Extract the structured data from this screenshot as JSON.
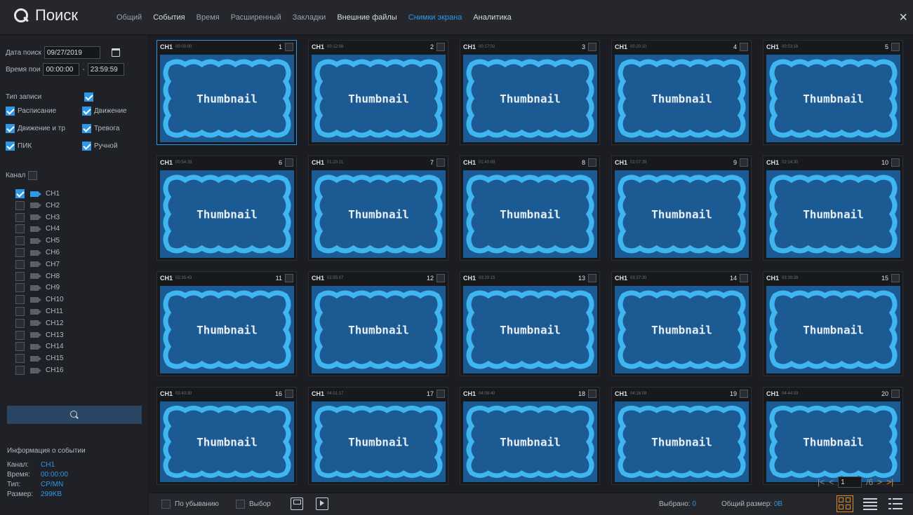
{
  "header": {
    "title": "Поиск",
    "tabs": [
      {
        "label": "Общий"
      },
      {
        "label": "События"
      },
      {
        "label": "Время"
      },
      {
        "label": "Расширенный"
      },
      {
        "label": "Закладки"
      },
      {
        "label": "Внешние файлы"
      },
      {
        "label": "Снимки экрана",
        "active": true
      },
      {
        "label": "Аналитика"
      }
    ],
    "close": "×"
  },
  "sidebar": {
    "date_label": "Дата поиск",
    "date_value": "09/27/2019",
    "time_label": "Время пои",
    "time_from": "00:00:00",
    "time_sep": "-",
    "time_to": "23:59:59",
    "rec_type_label": "Тип записи",
    "rec_types": [
      {
        "label": "Расписание"
      },
      {
        "label": "Движение"
      },
      {
        "label": "Движение и тр"
      },
      {
        "label": "Тревога"
      },
      {
        "label": "ПИК"
      },
      {
        "label": "Ручной"
      }
    ],
    "channel_label": "Канал",
    "channels": [
      "CH1",
      "CH2",
      "CH3",
      "CH4",
      "CH5",
      "CH6",
      "CH7",
      "CH8",
      "CH9",
      "CH10",
      "CH11",
      "CH12",
      "CH13",
      "CH14",
      "CH15",
      "CH16"
    ],
    "info_title": "Информация о событии",
    "info": {
      "channel_k": "Канал:",
      "channel_v": "CH1",
      "time_k": "Время:",
      "time_v": "00:00:00",
      "type_k": "Тип:",
      "type_v": "CP/MN",
      "size_k": "Размер:",
      "size_v": "299KB"
    }
  },
  "grid": {
    "thumbnail_text": "Thumbnail",
    "items": [
      {
        "ch": "CH1",
        "time": "00:00:00",
        "n": "1"
      },
      {
        "ch": "CH1",
        "time": "00:12:08",
        "n": "2"
      },
      {
        "ch": "CH1",
        "time": "00:17:02",
        "n": "3"
      },
      {
        "ch": "CH1",
        "time": "00:20:10",
        "n": "4"
      },
      {
        "ch": "CH1",
        "time": "00:53:16",
        "n": "5"
      },
      {
        "ch": "CH1",
        "time": "00:54:28",
        "n": "6"
      },
      {
        "ch": "CH1",
        "time": "01:20:21",
        "n": "7"
      },
      {
        "ch": "CH1",
        "time": "01:40:09",
        "n": "8"
      },
      {
        "ch": "CH1",
        "time": "02:07:39",
        "n": "9"
      },
      {
        "ch": "CH1",
        "time": "02:14:30",
        "n": "10"
      },
      {
        "ch": "CH1",
        "time": "02:35:43",
        "n": "11"
      },
      {
        "ch": "CH1",
        "time": "02:55:07",
        "n": "12"
      },
      {
        "ch": "CH1",
        "time": "03:20:15",
        "n": "13"
      },
      {
        "ch": "CH1",
        "time": "03:37:30",
        "n": "14"
      },
      {
        "ch": "CH1",
        "time": "03:38:28",
        "n": "15"
      },
      {
        "ch": "CH1",
        "time": "03:40:30",
        "n": "16"
      },
      {
        "ch": "CH1",
        "time": "04:01:17",
        "n": "17"
      },
      {
        "ch": "CH1",
        "time": "04:08:40",
        "n": "18"
      },
      {
        "ch": "CH1",
        "time": "04:16:08",
        "n": "19"
      },
      {
        "ch": "CH1",
        "time": "04:44:03",
        "n": "20"
      }
    ]
  },
  "pager": {
    "first": "|<",
    "prev": "<",
    "page": "1",
    "total": "/6",
    "next": ">",
    "last": ">|"
  },
  "bottom": {
    "desc_label": "По убыванию",
    "select_label": "Выбор",
    "selected_label": "Выбрано:",
    "selected_value": "0",
    "total_size_label": "Общий размер:",
    "total_size_value": "0B"
  },
  "colors": {
    "accent": "#2e97e6",
    "orange": "#e08a20",
    "thumb_bg": "#1c5a93",
    "thumb_frame": "#3fb6ef"
  }
}
